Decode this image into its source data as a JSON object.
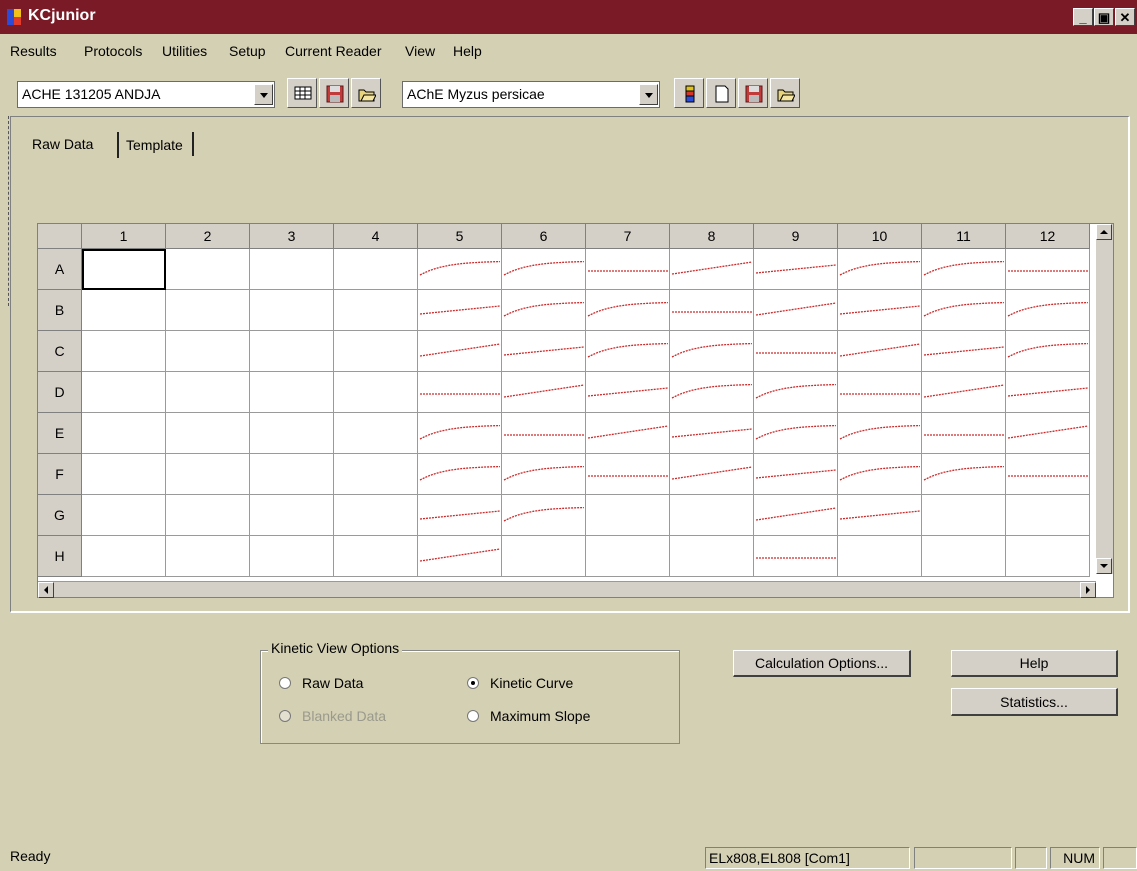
{
  "window": {
    "title": "KCjunior",
    "controls": [
      "_",
      "▣",
      "✕"
    ]
  },
  "menu": [
    "Results",
    "Protocols",
    "Utilities",
    "Setup",
    "Current Reader",
    "View",
    "Help"
  ],
  "toolbar": {
    "plate_select": "ACHE 131205 ANDJA",
    "protocol_select": "AChE Myzus persicae"
  },
  "tabs": [
    "Raw Data",
    "Template"
  ],
  "grid": {
    "columns": [
      "1",
      "2",
      "3",
      "4",
      "5",
      "6",
      "7",
      "8",
      "9",
      "10",
      "11",
      "12"
    ],
    "rows": [
      "A",
      "B",
      "C",
      "D",
      "E",
      "F",
      "G",
      "H"
    ]
  },
  "kinetic_options": {
    "title": "Kinetic View Options",
    "raw_data": "Raw Data",
    "blanked_data": "Blanked Data",
    "kinetic_curve": "Kinetic Curve",
    "maximum_slope": "Maximum Slope"
  },
  "buttons": {
    "calc": "Calculation Options...",
    "help": "Help",
    "stats": "Statistics..."
  },
  "status": {
    "text": "Ready",
    "reader": "ELx808,EL808 [Com1]",
    "num": "NUM"
  },
  "colors": {
    "title_bar": "#7a1a26",
    "curve": "#cc2a2a",
    "background": "#d4d0b4"
  }
}
